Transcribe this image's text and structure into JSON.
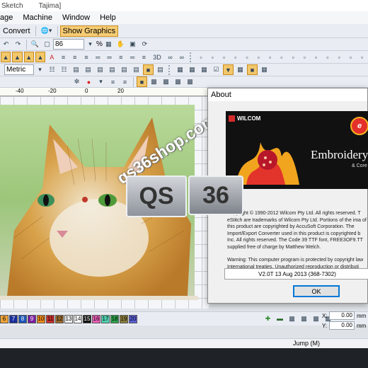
{
  "titlebar": {
    "items": [
      "Sketch",
      "Tajima]"
    ]
  },
  "menu": [
    "age",
    "Machine",
    "Window",
    "Help"
  ],
  "toolbar1": {
    "convert_label": "Convert",
    "show_graphics_label": "Show Graphics"
  },
  "toolbar2": {
    "zoom_value": "86",
    "zoom_unit": "%"
  },
  "toolbar4": {
    "units_value": "Metric"
  },
  "ruler": {
    "labels": [
      "-40",
      "-20",
      "0",
      "20"
    ]
  },
  "watermark": {
    "url_text": "qs36shop.com",
    "left_tile": "QS",
    "right_tile": "36"
  },
  "about_dialog": {
    "title": "About",
    "brand": "WILCOM",
    "product_text": "Embroidery",
    "product_sub": "& Core",
    "copyright_text": "Copyright © 1990-2012 Wilcom Pty Ltd. All rights reserved. T eStitch are trademarks of Wilcom Pty Ltd. Portions of the ima of this product are copyrighted by AccuSoft Corporation. The Import/Export Converter used in this product is copyrighted b Inc. All rights reserved. The Code 39 TTF font, FREE3OF9.TT supplied free of charge by Matthew Welch.",
    "warning_text": "Warning: This computer program is protected by copyright law International treaties. Unauthorized reproduction or distributi",
    "version": "V2.0T 13 Aug 2013 (368-7302)",
    "ok_label": "OK"
  },
  "palette": {
    "swatches": [
      {
        "n": "6",
        "c": "#f0a43a"
      },
      {
        "n": "7",
        "c": "#1b2f9b"
      },
      {
        "n": "8",
        "c": "#1c55b8"
      },
      {
        "n": "9",
        "c": "#7a1fa2"
      },
      {
        "n": "10",
        "c": "#ee8a1c"
      },
      {
        "n": "11",
        "c": "#c9302c"
      },
      {
        "n": "12",
        "c": "#9b6a2e"
      },
      {
        "n": "13",
        "c": "#f2f2f2"
      },
      {
        "n": "14",
        "c": "#ffffff"
      },
      {
        "n": "15",
        "c": "#111111"
      },
      {
        "n": "16",
        "c": "#e860b8"
      },
      {
        "n": "17",
        "c": "#4fd1b0"
      },
      {
        "n": "18",
        "c": "#2da24a"
      },
      {
        "n": "19",
        "c": "#8a7d3b"
      },
      {
        "n": "20",
        "c": "#5a5fd6"
      }
    ]
  },
  "coords": {
    "x_label": "X:",
    "x_value": "0.00",
    "y_label": "Y:",
    "y_value": "0.00",
    "unit": "mm"
  },
  "status": {
    "jump_text": "Jump (M)"
  }
}
